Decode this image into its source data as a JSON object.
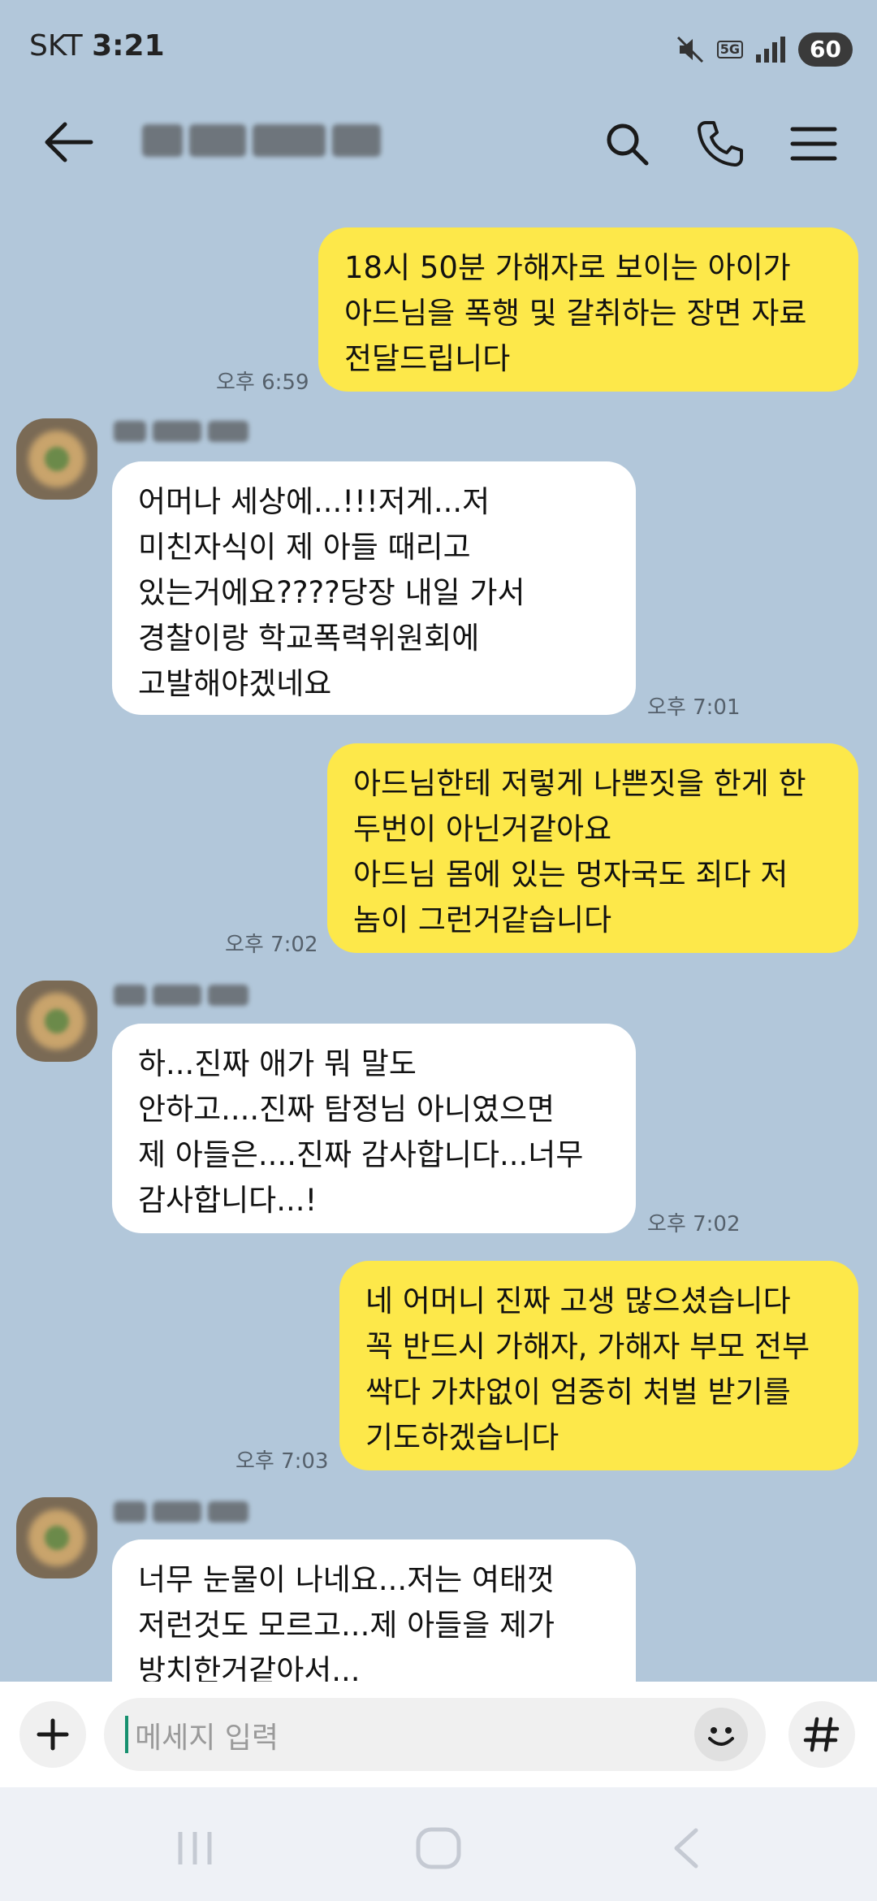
{
  "status_bar": {
    "carrier": "SKT",
    "time": "3:21",
    "network": "5G",
    "battery": "60"
  },
  "header": {
    "back_icon": "back-arrow-icon",
    "title_obscured": true,
    "icons": [
      "search-icon",
      "phone-icon",
      "menu-icon"
    ]
  },
  "messages": [
    {
      "direction": "outgoing",
      "text": "18시 50분 가해자로 보이는 아이가\n아드님을 폭행 및 갈취하는 장면 자료\n전달드립니다",
      "time": "오후 6:59"
    },
    {
      "direction": "incoming",
      "text": "어머나 세상에...!!!저게...저\n미친자식이 제 아들 때리고\n있는거에요????당장 내일 가서\n경찰이랑 학교폭력위원회에\n고발해야겠네요",
      "time": "오후 7:01"
    },
    {
      "direction": "outgoing",
      "text": "아드님한테 저렇게 나쁜짓을 한게 한\n두번이 아닌거같아요\n아드님 몸에 있는 멍자국도 죄다 저\n놈이 그런거같습니다",
      "time": "오후 7:02"
    },
    {
      "direction": "incoming",
      "text": "하...진짜 애가 뭐 말도\n안하고....진짜 탐정님 아니였으면\n제 아들은....진짜 감사합니다...너무\n감사합니다...!",
      "time": "오후 7:02"
    },
    {
      "direction": "outgoing",
      "text": "네 어머니 진짜 고생 많으셨습니다\n꼭 반드시 가해자, 가해자 부모 전부\n싹다 가차없이 엄중히 처벌 받기를\n기도하겠습니다",
      "time": "오후 7:03"
    },
    {
      "direction": "incoming",
      "text": "너무 눈물이 나네요...저는 여태껏\n저런것도 모르고...제 아들을 제가\n방치한거같아서...",
      "time": ""
    }
  ],
  "input": {
    "placeholder": "메세지 입력",
    "icons": [
      "plus-icon",
      "emoji-icon",
      "hashtag-icon"
    ]
  },
  "nav_bar": {
    "icons": [
      "recent-apps-icon",
      "home-icon",
      "back-icon"
    ]
  },
  "colors": {
    "background": "#b2c7da",
    "outgoing_bubble": "#fde84a",
    "incoming_bubble": "#ffffff"
  }
}
